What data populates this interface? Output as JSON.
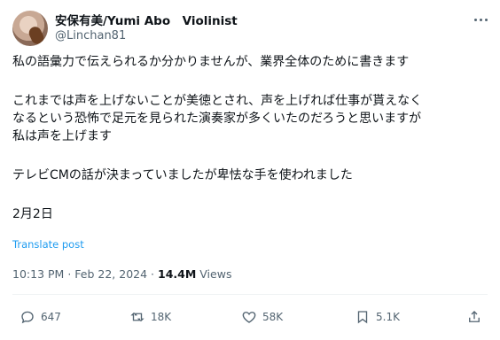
{
  "author": {
    "display_name": "安保有美/Yumi Abo　Violinist",
    "handle": "@Linchan81"
  },
  "post": {
    "lines": [
      "私の語彙力で伝えられるか分かりませんが、業界全体のために書きます",
      "",
      "これまでは声を上げないことが美徳とされ、声を上げれば仕事が貰えなく",
      "なるという恐怖で足元を見られた演奏家が多くいたのだろうと思いますが",
      "私は声を上げます",
      "",
      "テレビCMの話が決まっていましたが卑怯な手を使われました",
      "",
      "2月2日"
    ],
    "translate_label": "Translate post"
  },
  "meta": {
    "time": "10:13 PM",
    "separator": "·",
    "date": "Feb 22, 2024",
    "views_count": "14.4M",
    "views_label": "Views"
  },
  "actions": {
    "replies": "647",
    "reposts": "18K",
    "likes": "58K",
    "bookmarks": "5.1K"
  },
  "icons": {
    "more": "more-dots-icon",
    "reply": "reply-icon",
    "repost": "repost-icon",
    "like": "heart-icon",
    "bookmark": "bookmark-icon",
    "share": "share-icon"
  },
  "colors": {
    "link": "#1d9bf0",
    "secondary_text": "#536471",
    "primary_text": "#0f1419"
  }
}
